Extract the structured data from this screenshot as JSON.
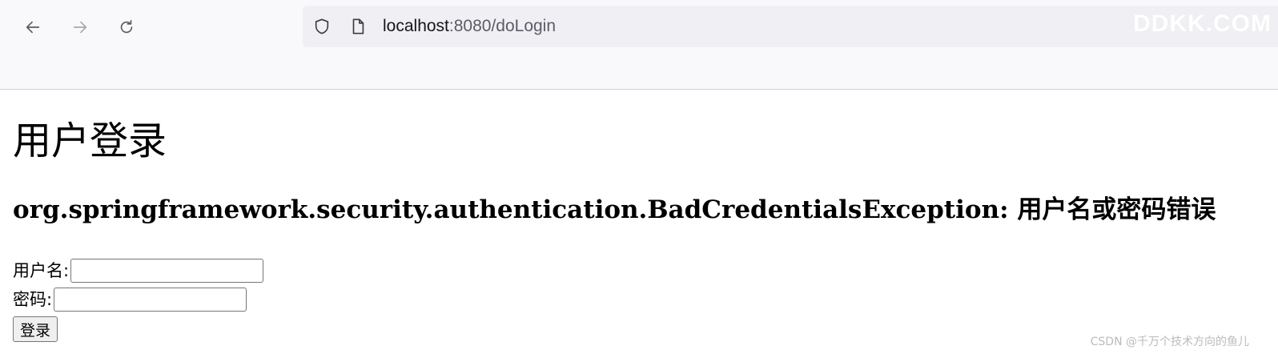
{
  "browser": {
    "url_host": "localhost",
    "url_rest": ":8080/doLogin",
    "watermark": "DDKK.COM",
    "icons": {
      "back": "arrow-left-icon",
      "forward": "arrow-right-icon",
      "reload": "reload-icon",
      "tracking": "shield-icon",
      "page": "page-icon"
    }
  },
  "page": {
    "title": "用户登录",
    "error_message": "org.springframework.security.authentication.BadCredentialsException: 用户名或密码错误",
    "username_label": "用户名:",
    "username_value": "",
    "password_label": "密码:",
    "password_value": "",
    "login_button": "登录",
    "footer_watermark": "CSDN @千万个技术方向的鱼儿"
  }
}
